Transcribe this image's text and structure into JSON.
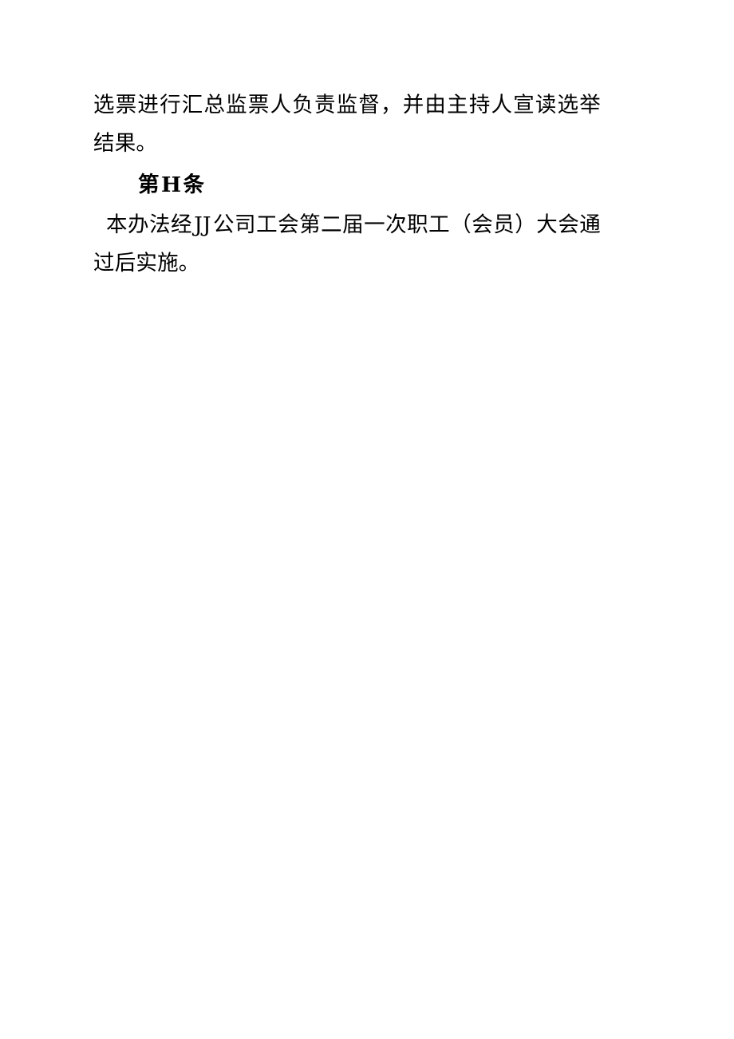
{
  "document": {
    "page_background": "#ffffff",
    "text_color": "#000000",
    "body": {
      "paragraph_continuation": "选票进行汇总监票人负责监督，并由主持人宣读选举结果。",
      "article_heading": {
        "prefix": "第",
        "number": "H",
        "suffix": "条"
      },
      "paragraph_closing": {
        "segment_1": "本办法经",
        "company_code": "JJ",
        "segment_2": "公司工会第二届一次职工（会员）大会通过后实施。"
      }
    }
  }
}
